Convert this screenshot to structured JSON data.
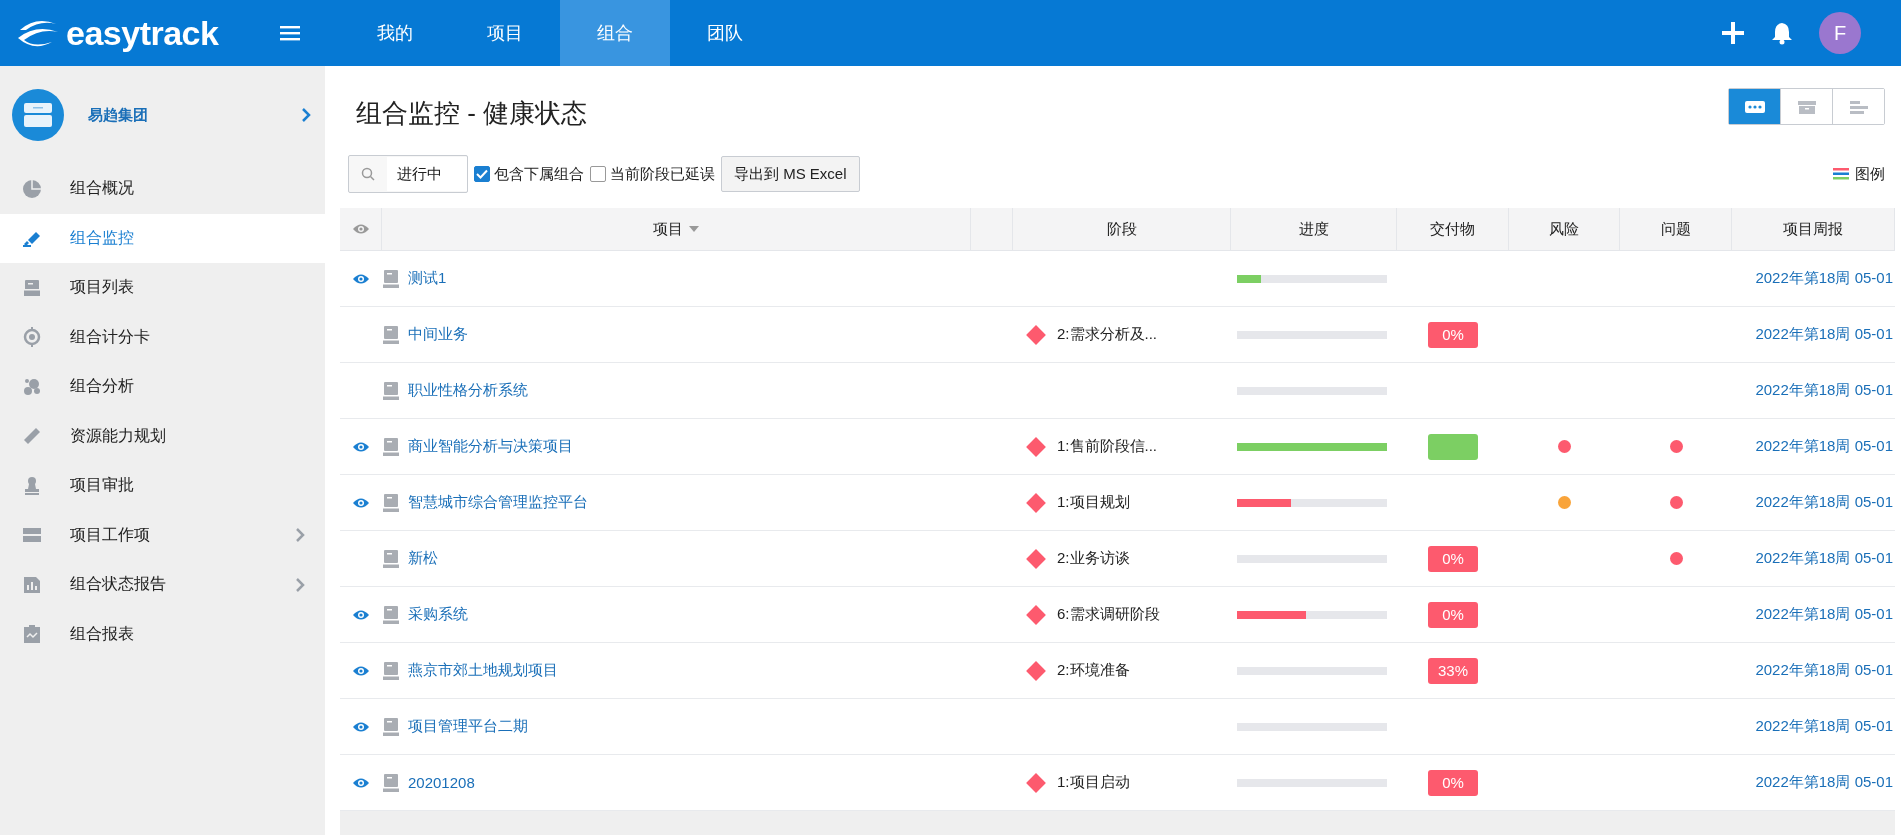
{
  "logo": "easytrack",
  "nav": [
    {
      "label": "我的",
      "selected": false
    },
    {
      "label": "项目",
      "selected": false
    },
    {
      "label": "组合",
      "selected": true
    },
    {
      "label": "团队",
      "selected": false
    }
  ],
  "user": {
    "initial": "F"
  },
  "sidebar": {
    "org": "易趋集团",
    "items": [
      {
        "label": "组合概况",
        "selected": false,
        "expandable": false
      },
      {
        "label": "组合监控",
        "selected": true,
        "expandable": false
      },
      {
        "label": "项目列表",
        "selected": false,
        "expandable": false
      },
      {
        "label": "组合计分卡",
        "selected": false,
        "expandable": false
      },
      {
        "label": "组合分析",
        "selected": false,
        "expandable": false
      },
      {
        "label": "资源能力规划",
        "selected": false,
        "expandable": false
      },
      {
        "label": "项目审批",
        "selected": false,
        "expandable": false
      },
      {
        "label": "项目工作项",
        "selected": false,
        "expandable": true
      },
      {
        "label": "组合状态报告",
        "selected": false,
        "expandable": true
      },
      {
        "label": "组合报表",
        "selected": false,
        "expandable": false
      }
    ]
  },
  "page_title": "组合监控 - 健康状态",
  "view_toggles": [
    {
      "selected": true
    },
    {
      "selected": false
    },
    {
      "selected": false
    }
  ],
  "filter": {
    "status": "进行中",
    "checkboxes": [
      {
        "label": "包含下属组合",
        "checked": true
      },
      {
        "label": "当前阶段已延误",
        "checked": false
      }
    ],
    "export_button": "导出到 MS Excel"
  },
  "legend": "图例",
  "table": {
    "columns": [
      "项目",
      "阶段",
      "进度",
      "交付物",
      "风险",
      "问题",
      "项目周报"
    ],
    "rows": [
      {
        "name": "测试1",
        "watched": true,
        "progress": {
          "level": 0.16,
          "color": "#7ccf63"
        },
        "report": "2022年第18周 05-01"
      },
      {
        "name": "中间业务",
        "watched": false,
        "stage": "2:需求分析及...",
        "deliverable": {
          "label": "0%",
          "color": "#fd5a6e"
        },
        "report": "2022年第18周 05-01"
      },
      {
        "name": "职业性格分析系统",
        "watched": false,
        "report": "2022年第18周 05-01"
      },
      {
        "name": "商业智能分析与决策项目",
        "watched": true,
        "stage": "1:售前阶段信...",
        "progress": {
          "level": 1,
          "color": "#7ccf63"
        },
        "deliverable": {
          "color": "#7ccf63"
        },
        "risk": {
          "color": "#fd5a6e"
        },
        "issue": {
          "color": "#fd5a6e"
        },
        "report": "2022年第18周 05-01"
      },
      {
        "name": "智慧城市综合管理监控平台",
        "watched": true,
        "stage": "1:项目规划",
        "progress": {
          "level": 0.36,
          "color": "#fd5a6e"
        },
        "risk": {
          "color": "#f9a43a"
        },
        "issue": {
          "color": "#fd5a6e"
        },
        "report": "2022年第18周 05-01"
      },
      {
        "name": "新松",
        "watched": false,
        "stage": "2:业务访谈",
        "deliverable": {
          "label": "0%",
          "color": "#fd5a6e"
        },
        "issue": {
          "color": "#fd5a6e"
        },
        "report": "2022年第18周 05-01"
      },
      {
        "name": "采购系统",
        "watched": true,
        "stage": "6:需求调研阶段",
        "progress": {
          "level": 0.46,
          "color": "#fd5a6e"
        },
        "deliverable": {
          "label": "0%",
          "color": "#fd5a6e"
        },
        "report": "2022年第18周 05-01"
      },
      {
        "name": "燕京市郊土地规划项目",
        "watched": true,
        "stage": "2:环境准备",
        "deliverable": {
          "label": "33%",
          "color": "#fd5a6e"
        },
        "report": "2022年第18周 05-01"
      },
      {
        "name": "项目管理平台二期",
        "watched": true,
        "report": "2022年第18周 05-01"
      },
      {
        "name": "20201208",
        "watched": true,
        "stage": "1:项目启动",
        "deliverable": {
          "label": "0%",
          "color": "#fd5a6e"
        },
        "report": "2022年第18周 05-01"
      }
    ]
  }
}
